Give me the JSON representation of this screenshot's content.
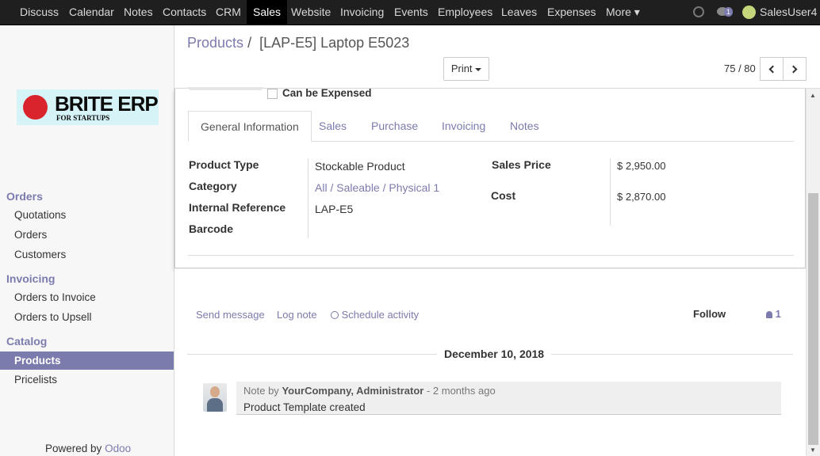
{
  "topbar": {
    "menu": [
      "Discuss",
      "Calendar",
      "Notes",
      "Contacts",
      "CRM",
      "Sales",
      "Website",
      "Invoicing",
      "Events",
      "Employees",
      "Leaves",
      "Expenses",
      "More"
    ],
    "active": "Sales",
    "chat_count": "1",
    "user": "SalesUser4",
    "more_caret": "▾"
  },
  "sidebar": {
    "logo_title": "BRITE ERP",
    "logo_subtitle": "FOR STARTUPS",
    "sections": [
      {
        "title": "Orders",
        "items": [
          "Quotations",
          "Orders",
          "Customers"
        ]
      },
      {
        "title": "Invoicing",
        "items": [
          "Orders to Invoice",
          "Orders to Upsell"
        ]
      },
      {
        "title": "Catalog",
        "items": [
          "Products",
          "Pricelists"
        ]
      }
    ],
    "active_item": "Products",
    "powered_prefix": "Powered by",
    "powered_brand": "Odoo"
  },
  "control_panel": {
    "breadcrumb_parent": "Products",
    "breadcrumb_sep": "/",
    "breadcrumb_current": "[LAP-E5] Laptop E5023",
    "print_label": "Print",
    "pager": "75 / 80"
  },
  "form": {
    "can_be_expensed": "Can be Expensed",
    "tabs": [
      "General Information",
      "Sales",
      "Purchase",
      "Invoicing",
      "Notes"
    ],
    "active_tab": "General Information",
    "fields_left": [
      {
        "label": "Product Type",
        "value": "Stockable Product"
      },
      {
        "label": "Category",
        "value": "All / Saleable / Physical 1"
      },
      {
        "label": "Internal Reference",
        "value": "LAP-E5"
      },
      {
        "label": "Barcode",
        "value": ""
      }
    ],
    "fields_right": [
      {
        "label": "Sales Price",
        "value": "$ 2,950.00"
      },
      {
        "label": "Cost",
        "value": "$ 2,870.00"
      }
    ]
  },
  "chatter": {
    "send_message": "Send message",
    "log_note": "Log note",
    "schedule_activity": "Schedule activity",
    "follow": "Follow",
    "followers": "1",
    "date": "December 10, 2018",
    "message": {
      "prefix": "Note by",
      "author": "YourCompany, Administrator",
      "time": "- 2 months ago",
      "body": "Product Template created"
    }
  }
}
